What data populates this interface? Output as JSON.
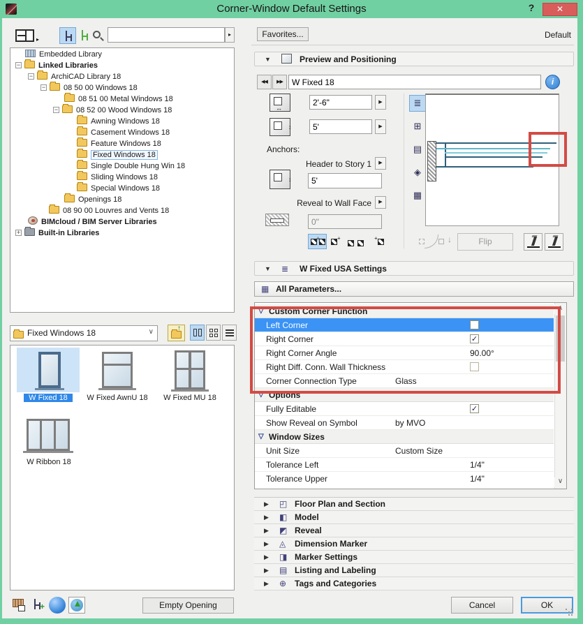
{
  "window": {
    "title": "Corner-Window Default Settings",
    "help_label": "?",
    "close_icon": "✕"
  },
  "icons": {
    "minus": "−",
    "plus": "+",
    "section_open": "▼",
    "group_open": "▽",
    "collapsed_arrow": "▶",
    "flyout_arrow": "▶",
    "prev": "◀◀",
    "next": "▶▶",
    "info": "i",
    "check": "✓",
    "scroll_up": "∧",
    "scroll_down": "∨",
    "select_chevron": "∨",
    "small_flyout": "▸",
    "up_arrow": "↑",
    "down_arrow": "↓",
    "plus_green": "+",
    "view_plan": "≣",
    "view_front": "⊞",
    "view_side": "▤",
    "view_3d": "◈",
    "view_film": "▦",
    "settings_glyph": "≣",
    "params_glyph": "▦",
    "preview_glyph": "◫",
    "width_arrow": "↔",
    "height_arrow": "↕",
    "anchor_arrow": "↕"
  },
  "library_panel": {
    "search_value": "",
    "tree": {
      "items": [
        {
          "label": "Embedded Library",
          "icon": "embedded-library-icon"
        },
        {
          "label": "Linked Libraries",
          "icon": "linked-libraries-folder-icon",
          "bold": true,
          "expanded": true
        },
        {
          "label": "ArchiCAD Library 18",
          "icon": "folder-icon",
          "expanded": true
        },
        {
          "label": "08 50 00 Windows 18",
          "icon": "folder-icon",
          "expanded": true
        },
        {
          "label": "08 51 00 Metal Windows 18",
          "icon": "folder-icon"
        },
        {
          "label": "08 52 00 Wood Windows 18",
          "icon": "folder-icon",
          "expanded": true
        },
        {
          "label": "Awning Windows 18",
          "icon": "folder-icon"
        },
        {
          "label": "Casement Windows 18",
          "icon": "folder-icon"
        },
        {
          "label": "Feature Windows 18",
          "icon": "folder-icon"
        },
        {
          "label": "Fixed Windows 18",
          "icon": "folder-icon",
          "selected": true
        },
        {
          "label": "Single Double Hung Win 18",
          "icon": "folder-icon"
        },
        {
          "label": "Sliding Windows 18",
          "icon": "folder-icon"
        },
        {
          "label": "Special Windows 18",
          "icon": "folder-icon"
        },
        {
          "label": "Openings 18",
          "icon": "folder-icon"
        },
        {
          "label": "08 90 00 Louvres and Vents 18",
          "icon": "folder-icon"
        },
        {
          "label": "BIMcloud / BIM Server Libraries",
          "icon": "bimcloud-icon",
          "bold": true
        },
        {
          "label": "Built-in Libraries",
          "icon": "dark-folder-icon",
          "bold": true,
          "collapsed": true
        }
      ]
    },
    "folder_select": "Fixed Windows 18",
    "thumbnails": [
      {
        "label": "W Fixed 18",
        "selected": true
      },
      {
        "label": "W Fixed AwnU 18"
      },
      {
        "label": "W Fixed MU 18"
      },
      {
        "label": "W Ribbon 18"
      }
    ],
    "empty_opening_label": "Empty Opening"
  },
  "right_panel": {
    "favorites_label": "Favorites...",
    "default_label": "Default",
    "preview": {
      "title": "Preview and Positioning",
      "object_name": "W Fixed 18",
      "width_value": "2'-6\"",
      "height_value": "5'",
      "anchors_label": "Anchors:",
      "header_anchor_label": "Header to Story 1",
      "header_anchor_value": "5'",
      "reveal_anchor_label": "Reveal to Wall Face",
      "reveal_value": "0\"",
      "flip_label": "Flip"
    },
    "settings": {
      "title": "W Fixed USA Settings",
      "all_parameters_label": "All Parameters..."
    },
    "parameters": {
      "rows": [
        {
          "type": "group",
          "label": "Custom Corner Function"
        },
        {
          "label": "Left Corner",
          "control": "checkbox",
          "checked": false,
          "selected": true
        },
        {
          "label": "Right Corner",
          "control": "checkbox",
          "checked": true
        },
        {
          "label": "Right Corner Angle",
          "value": "90.00°"
        },
        {
          "label": "Right Diff. Conn. Wall Thickness",
          "control": "checkbox",
          "checked": false,
          "disabled": true
        },
        {
          "label": "Corner Connection Type",
          "value": "Glass"
        },
        {
          "type": "group",
          "label": "Options"
        },
        {
          "label": "Fully Editable",
          "control": "checkbox",
          "checked": true
        },
        {
          "label": "Show Reveal on Symbol",
          "value": "by MVO"
        },
        {
          "type": "group",
          "label": "Window Sizes"
        },
        {
          "label": "Unit Size",
          "value": "Custom Size"
        },
        {
          "label": "Tolerance Left",
          "value": "1/4\""
        },
        {
          "label": "Tolerance Upper",
          "value": "1/4\""
        }
      ]
    },
    "sections": [
      {
        "label": "Floor Plan and Section",
        "icon": "floor-plan-and-section-icon",
        "glyph": "◰"
      },
      {
        "label": "Model",
        "icon": "model-icon",
        "glyph": "◧"
      },
      {
        "label": "Reveal",
        "icon": "reveal-icon",
        "glyph": "◩"
      },
      {
        "label": "Dimension Marker",
        "icon": "dimension-marker-icon",
        "glyph": "◬"
      },
      {
        "label": "Marker Settings",
        "icon": "marker-settings-icon",
        "glyph": "◨"
      },
      {
        "label": "Listing and Labeling",
        "icon": "listing-and-labeling-icon",
        "glyph": "▤"
      },
      {
        "label": "Tags and Categories",
        "icon": "tags-and-categories-icon",
        "glyph": "⊕"
      }
    ],
    "cancel_label": "Cancel",
    "ok_label": "OK"
  }
}
